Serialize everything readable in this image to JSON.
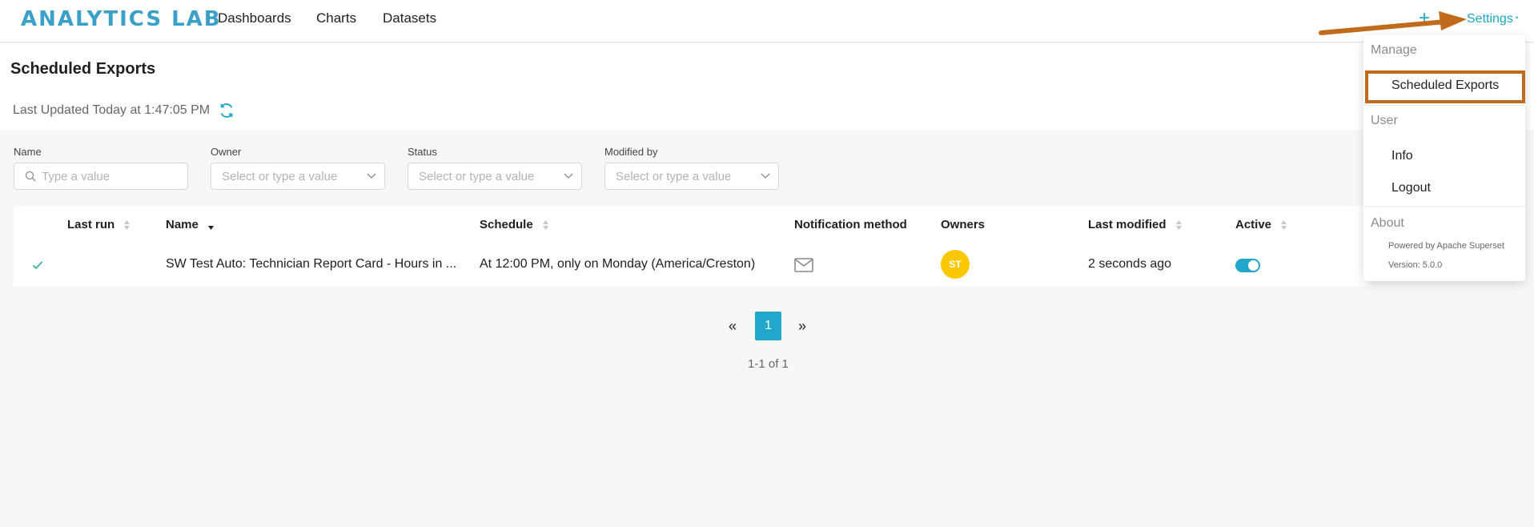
{
  "app": {
    "logo_text": "ANALYTICS LAB"
  },
  "nav": {
    "links": [
      "Dashboards",
      "Charts",
      "Datasets"
    ],
    "plus": "+",
    "settings": "Settings",
    "caret": "•"
  },
  "header": {
    "title": "Scheduled Exports",
    "last_updated": "Last Updated Today at 1:47:05 PM"
  },
  "filters": [
    {
      "label": "Name",
      "placeholder": "Type a value"
    },
    {
      "label": "Owner",
      "placeholder": "Select or type a value"
    },
    {
      "label": "Status",
      "placeholder": "Select or type a value"
    },
    {
      "label": "Modified by",
      "placeholder": "Select or type a value"
    }
  ],
  "table": {
    "columns": [
      "Last run",
      "Name",
      "Schedule",
      "Notification method",
      "Owners",
      "Last modified",
      "Active"
    ],
    "rows": [
      {
        "name": "SW Test Auto: Technician Report Card - Hours in ...",
        "schedule": "At 12:00 PM, only on Monday (America/Creston)",
        "owner_initials": "ST",
        "last_modified": "2 seconds ago"
      }
    ]
  },
  "pagination": {
    "prev": "«",
    "page": "1",
    "next": "»",
    "range": "1-1 of 1"
  },
  "menu": {
    "manage_header": "Manage",
    "scheduled_exports": "Scheduled Exports",
    "user_header": "User",
    "info": "Info",
    "logout": "Logout",
    "about_header": "About",
    "powered_by": "Powered by Apache Superset",
    "version": "Version: 5.0.0"
  },
  "colors": {
    "accent": "#20a7c9",
    "annotation": "#c26a1c",
    "avatar": "#fbc700"
  }
}
